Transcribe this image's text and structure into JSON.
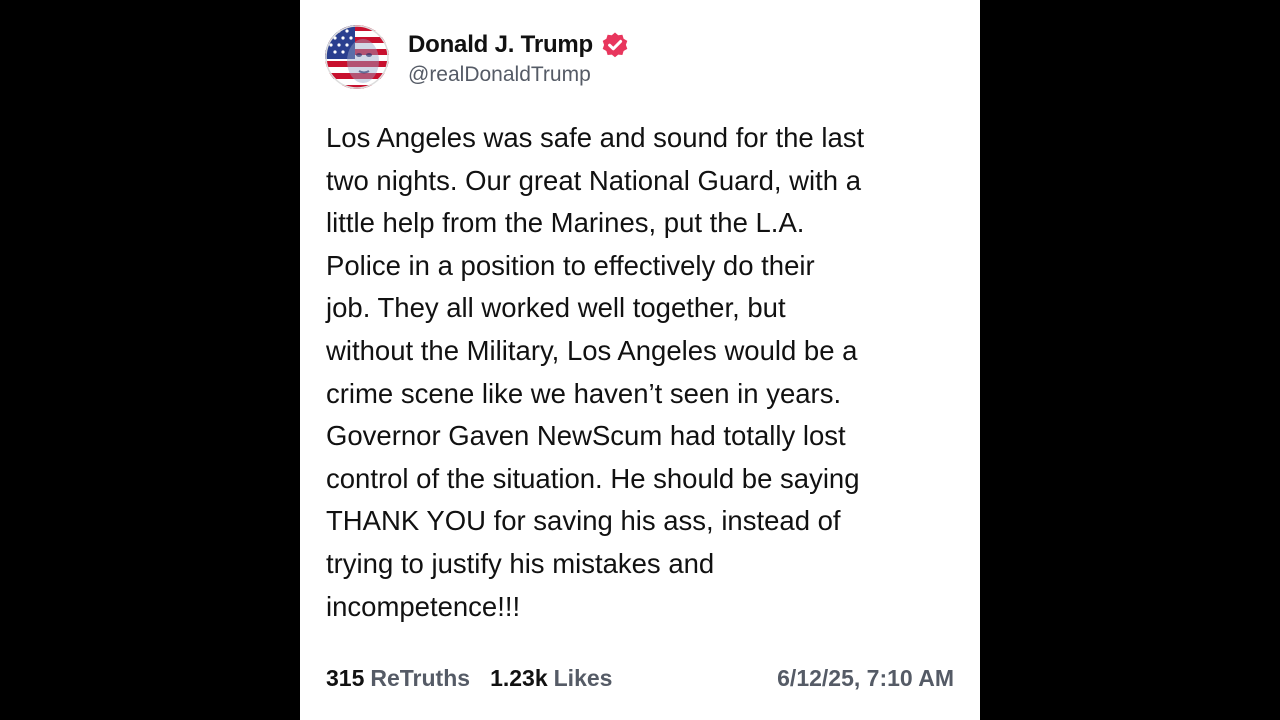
{
  "author": {
    "display_name": "Donald J. Trump",
    "handle": "@realDonaldTrump",
    "verified_icon": "verified-badge-icon",
    "avatar": "profile-avatar"
  },
  "post": {
    "text": "Los Angeles was safe and sound for the last\ntwo nights. Our great National Guard, with a\nlittle help from the Marines, put the L.A.\nPolice in a position to effectively do their\njob. They all worked well together, but\nwithout the Military, Los Angeles would be a\ncrime scene like we haven’t seen in years.\nGovernor Gaven NewScum had totally lost\ncontrol of the situation. He should be saying\nTHANK YOU for saving his ass, instead of\ntrying to justify his mistakes and\nincompetence!!!"
  },
  "stats": {
    "retruths_count": "315",
    "retruths_label": "ReTruths",
    "likes_count": "1.23k",
    "likes_label": "Likes",
    "timestamp": "6/12/25, 7:10 AM"
  },
  "colors": {
    "background": "#000000",
    "card": "#ffffff",
    "text": "#111111",
    "muted": "#555b66",
    "verified_badge": "#e8365d"
  }
}
